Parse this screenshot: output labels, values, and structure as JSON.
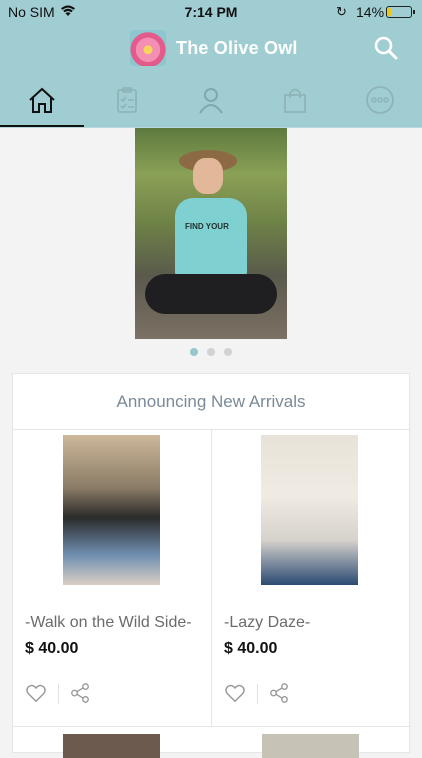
{
  "status_bar": {
    "carrier": "No SIM",
    "time": "7:14 PM",
    "battery": "14%",
    "battery_level": 0.14
  },
  "header": {
    "title": "The Olive Owl",
    "logo_icon": "flower-logo",
    "search_icon": "search-icon"
  },
  "tabs": [
    {
      "icon": "home-icon",
      "active": true
    },
    {
      "icon": "checklist-icon",
      "active": false
    },
    {
      "icon": "user-icon",
      "active": false
    },
    {
      "icon": "shopping-bag-icon",
      "active": false
    },
    {
      "icon": "more-icon",
      "active": false
    }
  ],
  "hero": {
    "shirt_text": "FIND YOUR",
    "slide_count": 3,
    "active_slide": 1
  },
  "section": {
    "title": "Announcing New Arrivals"
  },
  "products": [
    {
      "name": "-Walk on the Wild Side-",
      "price": "$ 40.00"
    },
    {
      "name": "-Lazy Daze-",
      "price": "$ 40.00"
    }
  ],
  "colors": {
    "brand": "#9fcdd2",
    "accent_dot": "#96c7cc"
  }
}
